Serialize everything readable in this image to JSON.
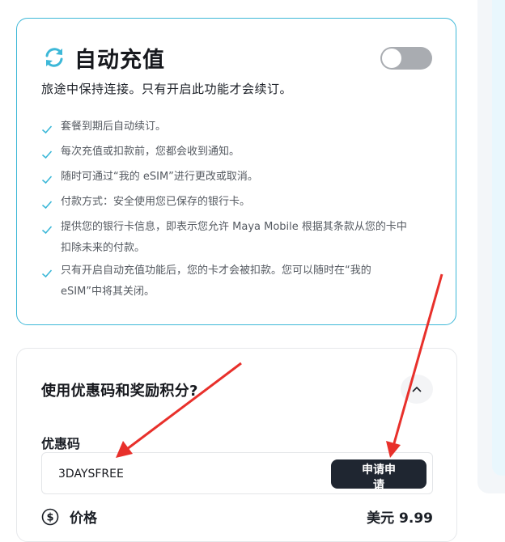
{
  "auto_topup": {
    "title": "自动充值",
    "subtitle": "旅途中保持连接。只有开启此功能才会续订。",
    "toggle_on": false,
    "accent_color": "#3db8d8",
    "features": [
      "套餐到期后自动续订。",
      "每次充值或扣款前，您都会收到通知。",
      "随时可通过“我的 eSIM”进行更改或取消。",
      "付款方式：安全使用您已保存的银行卡。",
      "提供您的银行卡信息，即表示您允许 Maya Mobile 根据其条款从您的卡中扣除未来的付款。",
      "只有开启自动充值功能后，您的卡才会被扣款。您可以随时在“我的 eSIM”中将其关闭。"
    ]
  },
  "promo": {
    "question": "使用优惠码和奖励积分?",
    "code_label": "优惠码",
    "code_value": "3DAYSFREE",
    "apply_label": "申请申请",
    "price_label": "价格",
    "price_value": "美元 9.99"
  },
  "colors": {
    "button_dark": "#1f2631",
    "arrow_red": "#e8302b",
    "check_blue": "#3db8d8"
  }
}
